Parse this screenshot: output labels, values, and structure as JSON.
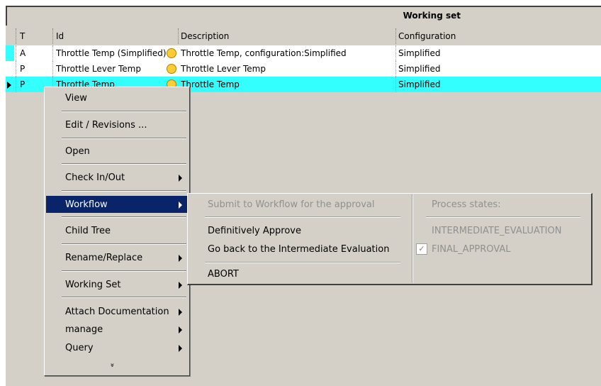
{
  "working_set": {
    "title": "Working set"
  },
  "columns": [
    "T",
    "Id",
    "Description",
    "Configuration"
  ],
  "rows": [
    {
      "t": "A",
      "id": "Throttle Temp (Simplified)",
      "description": "Throttle Temp, configuration:Simplified",
      "configuration": "Simplified",
      "status_color": "#ffcc33"
    },
    {
      "t": "P",
      "id": "Throttle Lever Temp",
      "description": "Throttle Lever Temp",
      "configuration": "Simplified",
      "status_color": "#ffcc33"
    },
    {
      "t": "P",
      "id": "Throttle Temp",
      "description": "Throttle Temp",
      "configuration": "Simplified",
      "status_color": "#ffcc33",
      "selected": true
    }
  ],
  "context_menu": {
    "items": [
      {
        "label": "View"
      },
      {
        "label": "Edit / Revisions ..."
      },
      {
        "label": "Open"
      },
      {
        "label": "Check In/Out"
      },
      {
        "label": "Workflow"
      },
      {
        "label": "Child Tree"
      },
      {
        "label": "Rename/Replace"
      },
      {
        "label": "Working Set"
      },
      {
        "label": "Attach Documentation"
      },
      {
        "label": "manage"
      },
      {
        "label": "Query"
      }
    ],
    "more": "»"
  },
  "workflow_submenu": {
    "submit": "Submit to Workflow for the approval",
    "approve": "Definitively Approve",
    "go_back": "Go back to the Intermediate Evaluation",
    "abort": "ABORT",
    "process_states_label": "Process states:",
    "states": [
      {
        "label": "INTERMEDIATE_EVALUATION",
        "checked": false
      },
      {
        "label": "FINAL_APPROVAL",
        "checked": true
      }
    ]
  },
  "colors": {
    "selection": "#33ffff",
    "menu_highlight": "#0a246a",
    "status_dot": "#ffcc33"
  }
}
